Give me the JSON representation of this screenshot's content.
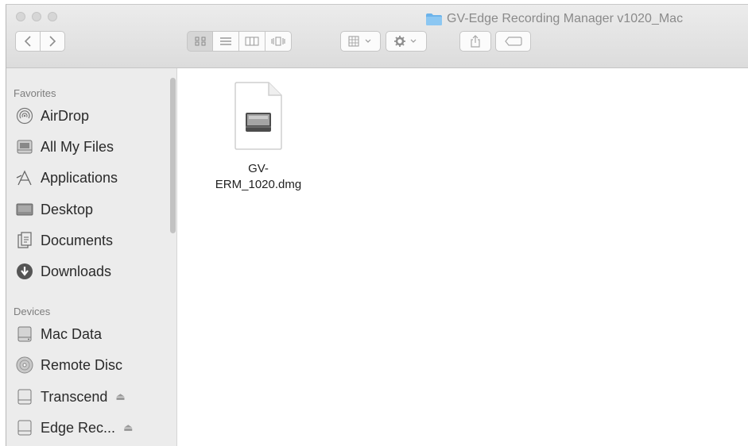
{
  "window": {
    "title": "GV-Edge Recording Manager v1020_Mac",
    "title_icon": "folder-icon"
  },
  "toolbar": {
    "back_icon": "chevron-left-icon",
    "forward_icon": "chevron-right-icon",
    "view_modes": [
      "icon-view-icon",
      "list-view-icon",
      "column-view-icon",
      "cover-flow-icon"
    ],
    "active_view": "icon-view-icon",
    "arrange_icon": "arrange-icon",
    "action_icon": "gear-icon",
    "share_icon": "share-icon",
    "tags_icon": "tag-icon"
  },
  "sidebar": {
    "favorites_header": "Favorites",
    "favorites": [
      {
        "label": "AirDrop",
        "icon": "airdrop-icon"
      },
      {
        "label": "All My Files",
        "icon": "all-files-icon"
      },
      {
        "label": "Applications",
        "icon": "applications-icon"
      },
      {
        "label": "Desktop",
        "icon": "desktop-icon"
      },
      {
        "label": "Documents",
        "icon": "documents-icon"
      },
      {
        "label": "Downloads",
        "icon": "downloads-icon"
      }
    ],
    "devices_header": "Devices",
    "devices": [
      {
        "label": "Mac Data",
        "icon": "hard-drive-icon"
      },
      {
        "label": "Remote Disc",
        "icon": "disc-icon"
      },
      {
        "label": "Transcend",
        "icon": "external-drive-icon",
        "eject": "⏏"
      },
      {
        "label": "Edge Rec...",
        "icon": "external-drive-icon",
        "eject": "⏏"
      }
    ]
  },
  "content": {
    "files": [
      {
        "name": "GV-\nERM_1020.dmg",
        "icon": "dmg-file-icon"
      }
    ]
  },
  "colors": {
    "toolbar_bg": "#e2e2e2",
    "sidebar_bg": "#ececec",
    "folder_blue": "#6cb3ea"
  }
}
